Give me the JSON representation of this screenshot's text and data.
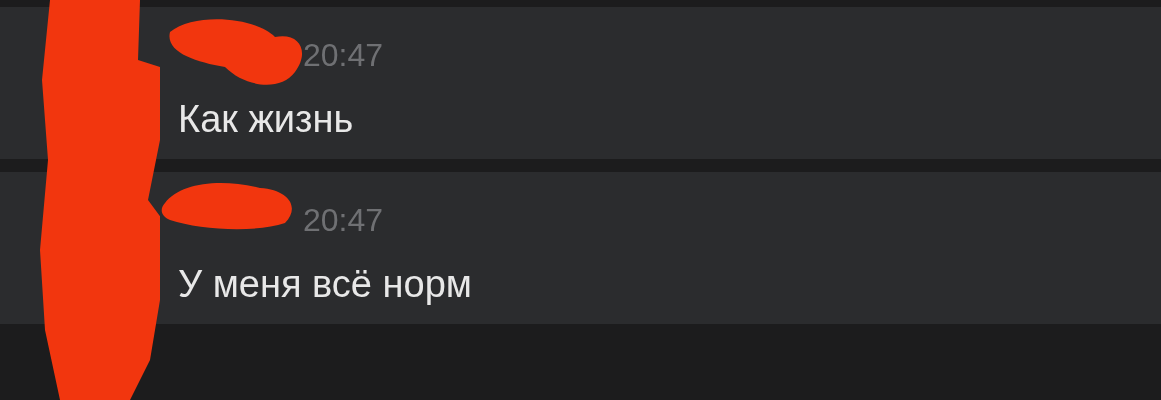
{
  "messages": [
    {
      "time": "20:47",
      "text": "Как жизнь"
    },
    {
      "time": "20:47",
      "text": "У меня всё норм"
    }
  ]
}
